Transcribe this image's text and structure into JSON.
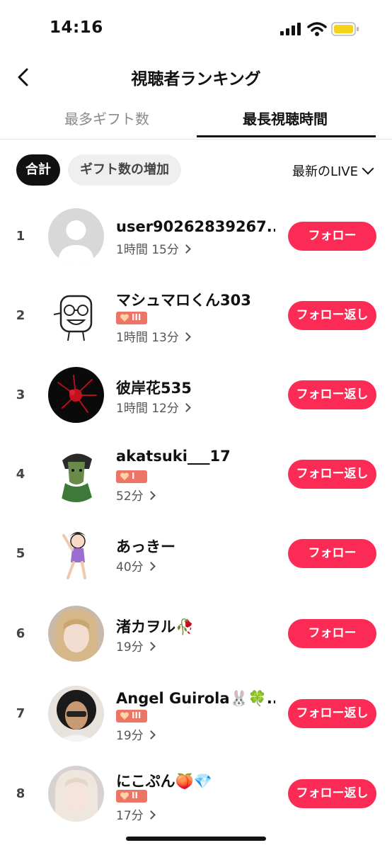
{
  "status": {
    "time": "14:16"
  },
  "nav": {
    "title": "視聴者ランキング"
  },
  "tabs": [
    {
      "label": "最多ギフト数"
    },
    {
      "label": "最長視聴時間"
    }
  ],
  "filters": {
    "chips": [
      {
        "label": "合計"
      },
      {
        "label": "ギフト数の増加"
      }
    ],
    "sort": "最新のLIVE"
  },
  "accent_color": "#fc2b55",
  "badge_color": "#ec7566",
  "viewers": [
    {
      "rank": "1",
      "name": "user90262839267...",
      "badge": "",
      "duration": "1時間 15分",
      "button": "フォロー"
    },
    {
      "rank": "2",
      "name": "マシュマロくん303",
      "badge": "III",
      "duration": "1時間 13分",
      "button": "フォロー返し"
    },
    {
      "rank": "3",
      "name": "彼岸花535",
      "badge": "",
      "duration": "1時間 12分",
      "button": "フォロー返し"
    },
    {
      "rank": "4",
      "name": "akatsuki___17",
      "badge": "I",
      "duration": "52分",
      "button": "フォロー返し"
    },
    {
      "rank": "5",
      "name": "あっきー",
      "badge": "",
      "duration": "40分",
      "button": "フォロー"
    },
    {
      "rank": "6",
      "name": "渚カヲル🥀",
      "badge": "",
      "duration": "19分",
      "button": "フォロー"
    },
    {
      "rank": "7",
      "name": "Angel Guirola🐰🍀...",
      "badge": "III",
      "duration": "19分",
      "button": "フォロー返し"
    },
    {
      "rank": "8",
      "name": "にこぷん🍑💎",
      "badge": "II",
      "duration": "17分",
      "button": "フォロー返し"
    }
  ]
}
